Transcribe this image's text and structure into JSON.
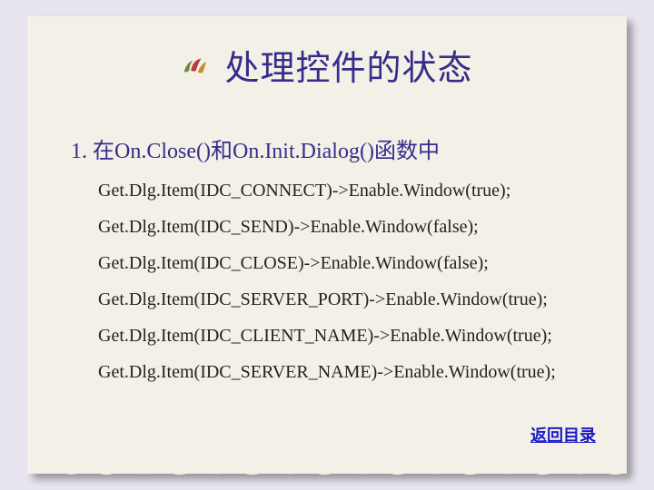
{
  "title": "处理控件的状态",
  "section_heading": "1. 在On.Close()和On.Init.Dialog()函数中",
  "code_lines": [
    "Get.Dlg.Item(IDC_CONNECT)->Enable.Window(true);",
    "Get.Dlg.Item(IDC_SEND)->Enable.Window(false);",
    "Get.Dlg.Item(IDC_CLOSE)->Enable.Window(false);",
    "Get.Dlg.Item(IDC_SERVER_PORT)->Enable.Window(true);",
    "Get.Dlg.Item(IDC_CLIENT_NAME)->Enable.Window(true);",
    "Get.Dlg.Item(IDC_SERVER_NAME)->Enable.Window(true);"
  ],
  "return_link": "返回目录",
  "colors": {
    "slide_bg": "#e8e4f0",
    "paper_bg": "#f3f0e7",
    "heading": "#372c8a",
    "body": "#222222",
    "link": "#1a1ac4"
  }
}
